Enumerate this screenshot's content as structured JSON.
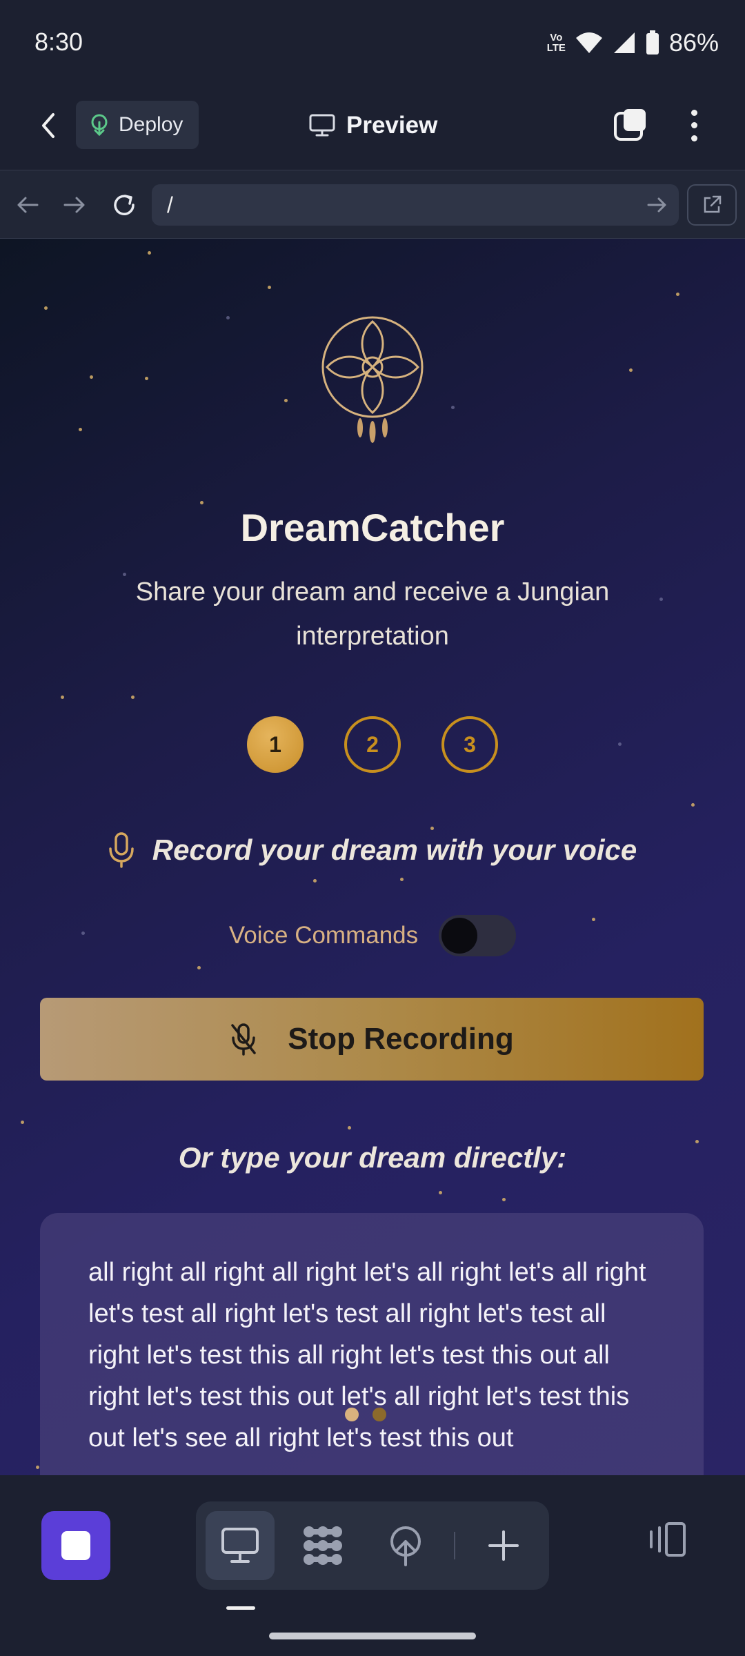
{
  "status_bar": {
    "time": "8:30",
    "network": "LTE",
    "battery": "86%"
  },
  "header": {
    "deploy_label": "Deploy",
    "preview_label": "Preview"
  },
  "browser": {
    "url": "/"
  },
  "app": {
    "title": "DreamCatcher",
    "subtitle": "Share your dream and receive a Jungian interpretation",
    "steps": [
      {
        "label": "1"
      },
      {
        "label": "2"
      },
      {
        "label": "3"
      }
    ],
    "active_step": 1,
    "record_hint": "Record your dream with your voice",
    "voice_commands_label": "Voice Commands",
    "voice_commands_enabled": false,
    "stop_recording_label": "Stop Recording",
    "type_hint": "Or type your dream directly:",
    "dream_text": "all right all right all right let's all right let's all right let's test all right let's test all right let's test all right let's test this all right let's test this out all right let's test this out let's all right let's test this out let's see all right let's test this out"
  },
  "colors": {
    "accent_gold": "#c8901e",
    "primary_purple": "#5b3ed8",
    "background": "#1c2030"
  },
  "bottom_nav": {
    "tools": [
      {
        "name": "preview-tool",
        "icon": "monitor-icon",
        "active": true
      },
      {
        "name": "workflow-tool",
        "icon": "nodes-icon",
        "active": false
      },
      {
        "name": "deploy-tool",
        "icon": "deploy-icon",
        "active": false
      },
      {
        "name": "add-tool",
        "icon": "plus-icon",
        "active": false
      }
    ]
  }
}
